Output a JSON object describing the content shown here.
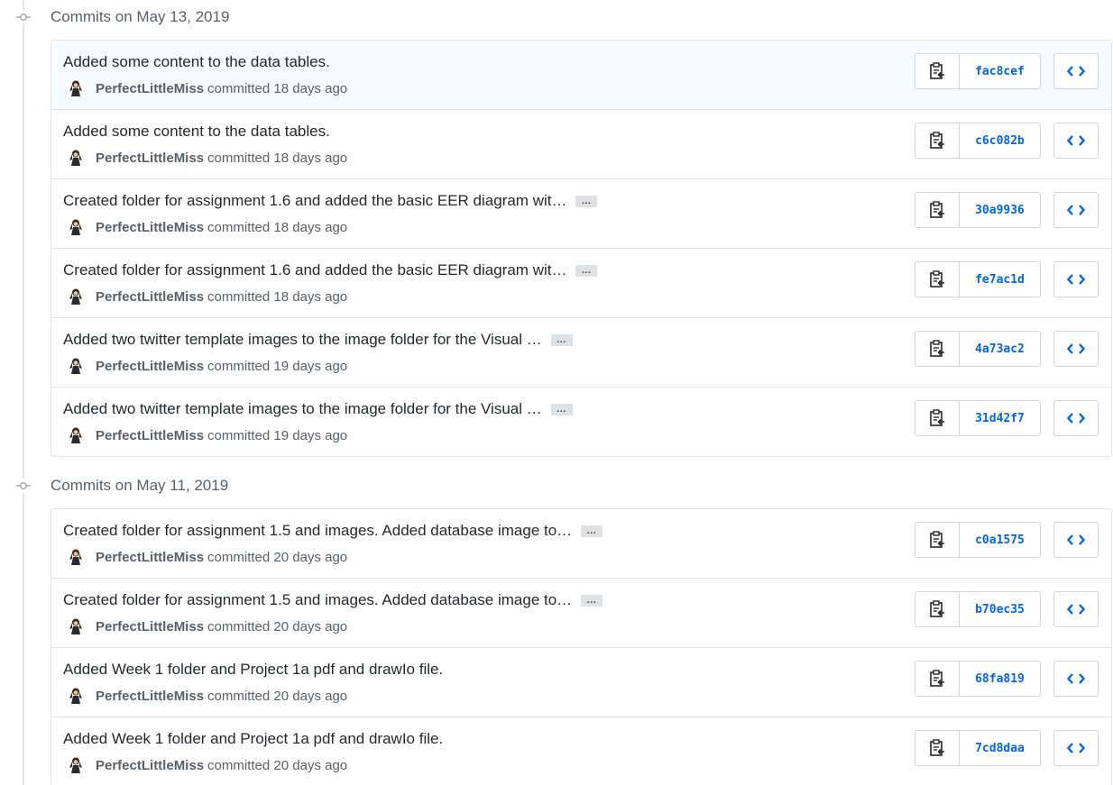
{
  "colors": {
    "accent": "#0366d6",
    "text": "#24292e",
    "muted": "#586069",
    "border": "#e1e4e8",
    "highlight_row": "#f6fbff"
  },
  "groups": [
    {
      "title": "Commits on May 13, 2019",
      "commits": [
        {
          "message": "Added some content to the data tables.",
          "truncated": false,
          "author": "PerfectLittleMiss",
          "committed_label": "committed",
          "time": "18 days ago",
          "sha": "fac8cef",
          "ellipsis": "…"
        },
        {
          "message": "Added some content to the data tables.",
          "truncated": false,
          "author": "PerfectLittleMiss",
          "committed_label": "committed",
          "time": "18 days ago",
          "sha": "c6c082b",
          "ellipsis": "…"
        },
        {
          "message": "Created folder for assignment 1.6 and added the basic EER diagram wit…",
          "truncated": true,
          "author": "PerfectLittleMiss",
          "committed_label": "committed",
          "time": "18 days ago",
          "sha": "30a9936",
          "ellipsis": "…"
        },
        {
          "message": "Created folder for assignment 1.6 and added the basic EER diagram wit…",
          "truncated": true,
          "author": "PerfectLittleMiss",
          "committed_label": "committed",
          "time": "18 days ago",
          "sha": "fe7ac1d",
          "ellipsis": "…"
        },
        {
          "message": "Added two twitter template images to the image folder for the Visual …",
          "truncated": true,
          "author": "PerfectLittleMiss",
          "committed_label": "committed",
          "time": "19 days ago",
          "sha": "4a73ac2",
          "ellipsis": "…"
        },
        {
          "message": "Added two twitter template images to the image folder for the Visual …",
          "truncated": true,
          "author": "PerfectLittleMiss",
          "committed_label": "committed",
          "time": "19 days ago",
          "sha": "31d42f7",
          "ellipsis": "…"
        }
      ]
    },
    {
      "title": "Commits on May 11, 2019",
      "commits": [
        {
          "message": "Created folder for assignment 1.5 and images. Added database image to…",
          "truncated": true,
          "author": "PerfectLittleMiss",
          "committed_label": "committed",
          "time": "20 days ago",
          "sha": "c0a1575",
          "ellipsis": "…"
        },
        {
          "message": "Created folder for assignment 1.5 and images. Added database image to…",
          "truncated": true,
          "author": "PerfectLittleMiss",
          "committed_label": "committed",
          "time": "20 days ago",
          "sha": "b70ec35",
          "ellipsis": "…"
        },
        {
          "message": "Added Week 1 folder and Project 1a pdf and drawIo file.",
          "truncated": false,
          "author": "PerfectLittleMiss",
          "committed_label": "committed",
          "time": "20 days ago",
          "sha": "68fa819",
          "ellipsis": "…"
        },
        {
          "message": "Added Week 1 folder and Project 1a pdf and drawIo file.",
          "truncated": false,
          "author": "PerfectLittleMiss",
          "committed_label": "committed",
          "time": "20 days ago",
          "sha": "7cd8daa",
          "ellipsis": "…"
        }
      ]
    }
  ]
}
